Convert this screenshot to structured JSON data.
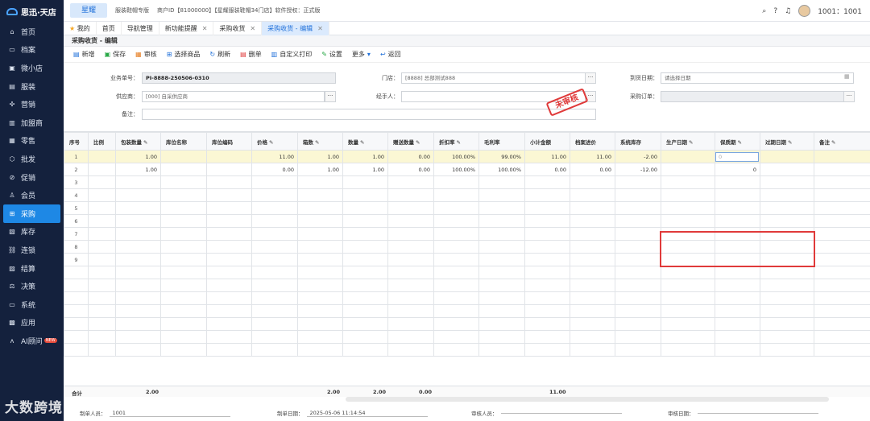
{
  "app": {
    "logo": "思迅·天店",
    "brand_tab": "星耀",
    "edition": "服装鞋帽专版",
    "shop_info": "商户ID【81000000】【星耀服装鞋帽34门店】软件授权：正式版",
    "user": "1001：1001"
  },
  "sidebar": {
    "items": [
      {
        "icon": "home-icon",
        "glyph": "⌂",
        "label": "首页"
      },
      {
        "icon": "folder-icon",
        "glyph": "▭",
        "label": "档案"
      },
      {
        "icon": "store-icon",
        "glyph": "▣",
        "label": "微小店"
      },
      {
        "icon": "clothes-icon",
        "glyph": "▤",
        "label": "服装"
      },
      {
        "icon": "marketing-icon",
        "glyph": "✣",
        "label": "营销"
      },
      {
        "icon": "franchise-icon",
        "glyph": "▥",
        "label": "加盟商"
      },
      {
        "icon": "retail-icon",
        "glyph": "▦",
        "label": "零售"
      },
      {
        "icon": "wholesale-icon",
        "glyph": "⬡",
        "label": "批发"
      },
      {
        "icon": "promotion-icon",
        "glyph": "⊘",
        "label": "促销"
      },
      {
        "icon": "member-icon",
        "glyph": "♙",
        "label": "会员"
      },
      {
        "icon": "cart-icon",
        "glyph": "⊞",
        "label": "采购",
        "active": true
      },
      {
        "icon": "inventory-icon",
        "glyph": "▧",
        "label": "库存"
      },
      {
        "icon": "chain-icon",
        "glyph": "⛓",
        "label": "连锁"
      },
      {
        "icon": "settlement-icon",
        "glyph": "▨",
        "label": "结算"
      },
      {
        "icon": "decision-icon",
        "glyph": "⚖",
        "label": "决策"
      },
      {
        "icon": "system-icon",
        "glyph": "▭",
        "label": "系统"
      },
      {
        "icon": "app-icon",
        "glyph": "▩",
        "label": "应用"
      },
      {
        "icon": "ai-icon",
        "glyph": "ʌ",
        "label": "AI顾问",
        "badge": "NEW"
      }
    ]
  },
  "tabs": [
    {
      "label": "我的",
      "star": true
    },
    {
      "label": "首页"
    },
    {
      "label": "导航管理"
    },
    {
      "label": "新功能提醒",
      "closable": true
    },
    {
      "label": "采购收货",
      "closable": true
    },
    {
      "label": "采购收货 - 编辑",
      "closable": true,
      "active": true
    }
  ],
  "page": {
    "title": "采购收货 - 编辑"
  },
  "toolbar": [
    {
      "icon": "add-icon",
      "glyph": "▤",
      "label": "新增",
      "color": "#1e6fd9"
    },
    {
      "icon": "save-icon",
      "glyph": "▣",
      "label": "保存",
      "color": "#27a745"
    },
    {
      "icon": "audit-icon",
      "glyph": "▦",
      "label": "审核",
      "color": "#e67e22"
    },
    {
      "icon": "select-goods-icon",
      "glyph": "⊞",
      "label": "选择商品",
      "color": "#1e6fd9"
    },
    {
      "icon": "refresh-icon",
      "glyph": "↻",
      "label": "刷新",
      "color": "#1e6fd9"
    },
    {
      "icon": "delete-icon",
      "glyph": "▤",
      "label": "删单",
      "color": "#e03a3a"
    },
    {
      "icon": "print-icon",
      "glyph": "▥",
      "label": "自定义打印",
      "color": "#1e6fd9"
    },
    {
      "icon": "settings-icon",
      "glyph": "✎",
      "label": "设置",
      "color": "#27a745"
    },
    {
      "icon": "more-icon",
      "glyph": "▾",
      "label": "更多",
      "color": "#1e6fd9"
    },
    {
      "icon": "back-icon",
      "glyph": "↩",
      "label": "返回",
      "color": "#1e6fd9"
    }
  ],
  "form": {
    "order_no_label": "业务单号：",
    "order_no": "PI-8888-250506-0310",
    "store_label": "门店：",
    "store": "[8888] 总部测试888",
    "arrival_label": "到货日期：",
    "arrival_placeholder": "请选择日期",
    "supplier_label": "供应商：",
    "supplier": "[000] 自采供应商",
    "handler_label": "经手人：",
    "handler": "",
    "po_label": "采购订单：",
    "po": "",
    "remark_label": "备注：",
    "remark": "",
    "stamp": "未审核"
  },
  "grid": {
    "columns": [
      {
        "label": "序号",
        "edit": false
      },
      {
        "label": "比例",
        "edit": false
      },
      {
        "label": "包装数量",
        "edit": true
      },
      {
        "label": "库位名称",
        "edit": false
      },
      {
        "label": "库位编码",
        "edit": false
      },
      {
        "label": "价格",
        "edit": true
      },
      {
        "label": "箱数",
        "edit": true
      },
      {
        "label": "数量",
        "edit": true
      },
      {
        "label": "赠送数量",
        "edit": true
      },
      {
        "label": "折扣率",
        "edit": true
      },
      {
        "label": "毛利率",
        "edit": false
      },
      {
        "label": "小计金额",
        "edit": false
      },
      {
        "label": "档案进价",
        "edit": false
      },
      {
        "label": "系统库存",
        "edit": false
      },
      {
        "label": "生产日期",
        "edit": true
      },
      {
        "label": "保质期",
        "edit": true
      },
      {
        "label": "过期日期",
        "edit": true
      },
      {
        "label": "备注",
        "edit": true
      }
    ],
    "rows": [
      [
        "1",
        "",
        "1.00",
        "",
        "",
        "11.00",
        "1.00",
        "1.00",
        "0.00",
        "100.00%",
        "99.00%",
        "11.00",
        "11.00",
        "-2.00",
        "",
        "0",
        "",
        " "
      ],
      [
        "2",
        "",
        "1.00",
        "",
        "",
        "0.00",
        "1.00",
        "1.00",
        "0.00",
        "100.00%",
        "100.00%",
        "0.00",
        "0.00",
        "-12.00",
        "",
        "0",
        "",
        ""
      ],
      [
        "3",
        "",
        "",
        "",
        "",
        "",
        "",
        "",
        "",
        "",
        "",
        "",
        "",
        "",
        "",
        "",
        "",
        ""
      ],
      [
        "4",
        "",
        "",
        "",
        "",
        "",
        "",
        "",
        "",
        "",
        "",
        "",
        "",
        "",
        "",
        "",
        "",
        ""
      ],
      [
        "5",
        "",
        "",
        "",
        "",
        "",
        "",
        "",
        "",
        "",
        "",
        "",
        "",
        "",
        "",
        "",
        "",
        ""
      ],
      [
        "6",
        "",
        "",
        "",
        "",
        "",
        "",
        "",
        "",
        "",
        "",
        "",
        "",
        "",
        "",
        "",
        "",
        ""
      ],
      [
        "7",
        "",
        "",
        "",
        "",
        "",
        "",
        "",
        "",
        "",
        "",
        "",
        "",
        "",
        "",
        "",
        "",
        ""
      ],
      [
        "8",
        "",
        "",
        "",
        "",
        "",
        "",
        "",
        "",
        "",
        "",
        "",
        "",
        "",
        "",
        "",
        "",
        ""
      ],
      [
        "9",
        "",
        "",
        "",
        "",
        "",
        "",
        "",
        "",
        "",
        "",
        "",
        "",
        "",
        "",
        "",
        "",
        ""
      ]
    ],
    "totals": {
      "label": "合计",
      "pack_qty": "2.00",
      "boxes": "2.00",
      "qty": "2.00",
      "gift": "0.00",
      "subtotal": "11.00"
    }
  },
  "footer": {
    "maker_label": "制单人员：",
    "maker": "1001",
    "date_label": "制单日期：",
    "date": "2025-05-06 11:14:54",
    "auditor_label": "审核人员：",
    "auditor": "",
    "audit_date_label": "审核日期：",
    "audit_date": ""
  },
  "watermark": "大数跨境"
}
